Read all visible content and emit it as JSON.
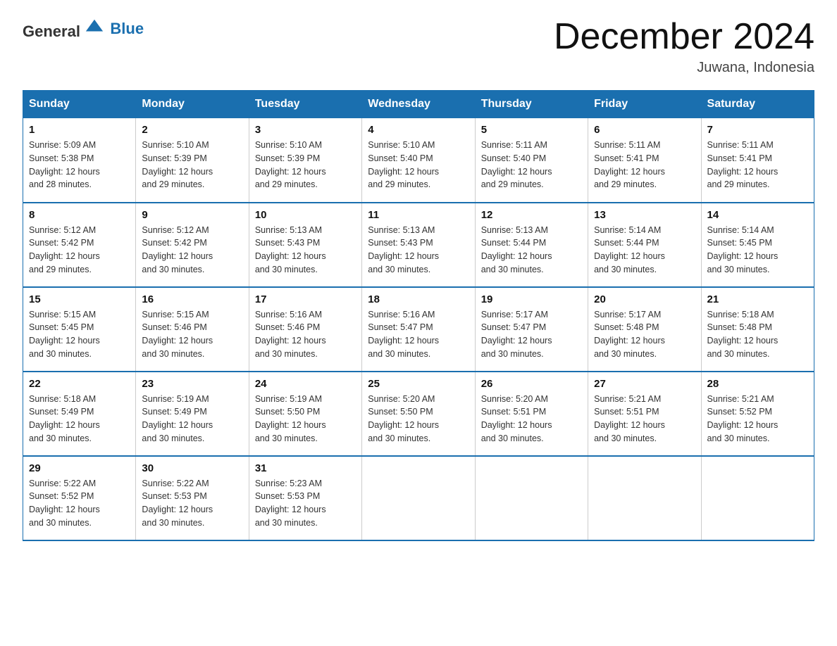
{
  "header": {
    "logo_general": "General",
    "logo_blue": "Blue",
    "title": "December 2024",
    "subtitle": "Juwana, Indonesia"
  },
  "days_of_week": [
    "Sunday",
    "Monday",
    "Tuesday",
    "Wednesday",
    "Thursday",
    "Friday",
    "Saturday"
  ],
  "weeks": [
    [
      {
        "day": "1",
        "sunrise": "5:09 AM",
        "sunset": "5:38 PM",
        "daylight": "12 hours and 28 minutes."
      },
      {
        "day": "2",
        "sunrise": "5:10 AM",
        "sunset": "5:39 PM",
        "daylight": "12 hours and 29 minutes."
      },
      {
        "day": "3",
        "sunrise": "5:10 AM",
        "sunset": "5:39 PM",
        "daylight": "12 hours and 29 minutes."
      },
      {
        "day": "4",
        "sunrise": "5:10 AM",
        "sunset": "5:40 PM",
        "daylight": "12 hours and 29 minutes."
      },
      {
        "day": "5",
        "sunrise": "5:11 AM",
        "sunset": "5:40 PM",
        "daylight": "12 hours and 29 minutes."
      },
      {
        "day": "6",
        "sunrise": "5:11 AM",
        "sunset": "5:41 PM",
        "daylight": "12 hours and 29 minutes."
      },
      {
        "day": "7",
        "sunrise": "5:11 AM",
        "sunset": "5:41 PM",
        "daylight": "12 hours and 29 minutes."
      }
    ],
    [
      {
        "day": "8",
        "sunrise": "5:12 AM",
        "sunset": "5:42 PM",
        "daylight": "12 hours and 29 minutes."
      },
      {
        "day": "9",
        "sunrise": "5:12 AM",
        "sunset": "5:42 PM",
        "daylight": "12 hours and 30 minutes."
      },
      {
        "day": "10",
        "sunrise": "5:13 AM",
        "sunset": "5:43 PM",
        "daylight": "12 hours and 30 minutes."
      },
      {
        "day": "11",
        "sunrise": "5:13 AM",
        "sunset": "5:43 PM",
        "daylight": "12 hours and 30 minutes."
      },
      {
        "day": "12",
        "sunrise": "5:13 AM",
        "sunset": "5:44 PM",
        "daylight": "12 hours and 30 minutes."
      },
      {
        "day": "13",
        "sunrise": "5:14 AM",
        "sunset": "5:44 PM",
        "daylight": "12 hours and 30 minutes."
      },
      {
        "day": "14",
        "sunrise": "5:14 AM",
        "sunset": "5:45 PM",
        "daylight": "12 hours and 30 minutes."
      }
    ],
    [
      {
        "day": "15",
        "sunrise": "5:15 AM",
        "sunset": "5:45 PM",
        "daylight": "12 hours and 30 minutes."
      },
      {
        "day": "16",
        "sunrise": "5:15 AM",
        "sunset": "5:46 PM",
        "daylight": "12 hours and 30 minutes."
      },
      {
        "day": "17",
        "sunrise": "5:16 AM",
        "sunset": "5:46 PM",
        "daylight": "12 hours and 30 minutes."
      },
      {
        "day": "18",
        "sunrise": "5:16 AM",
        "sunset": "5:47 PM",
        "daylight": "12 hours and 30 minutes."
      },
      {
        "day": "19",
        "sunrise": "5:17 AM",
        "sunset": "5:47 PM",
        "daylight": "12 hours and 30 minutes."
      },
      {
        "day": "20",
        "sunrise": "5:17 AM",
        "sunset": "5:48 PM",
        "daylight": "12 hours and 30 minutes."
      },
      {
        "day": "21",
        "sunrise": "5:18 AM",
        "sunset": "5:48 PM",
        "daylight": "12 hours and 30 minutes."
      }
    ],
    [
      {
        "day": "22",
        "sunrise": "5:18 AM",
        "sunset": "5:49 PM",
        "daylight": "12 hours and 30 minutes."
      },
      {
        "day": "23",
        "sunrise": "5:19 AM",
        "sunset": "5:49 PM",
        "daylight": "12 hours and 30 minutes."
      },
      {
        "day": "24",
        "sunrise": "5:19 AM",
        "sunset": "5:50 PM",
        "daylight": "12 hours and 30 minutes."
      },
      {
        "day": "25",
        "sunrise": "5:20 AM",
        "sunset": "5:50 PM",
        "daylight": "12 hours and 30 minutes."
      },
      {
        "day": "26",
        "sunrise": "5:20 AM",
        "sunset": "5:51 PM",
        "daylight": "12 hours and 30 minutes."
      },
      {
        "day": "27",
        "sunrise": "5:21 AM",
        "sunset": "5:51 PM",
        "daylight": "12 hours and 30 minutes."
      },
      {
        "day": "28",
        "sunrise": "5:21 AM",
        "sunset": "5:52 PM",
        "daylight": "12 hours and 30 minutes."
      }
    ],
    [
      {
        "day": "29",
        "sunrise": "5:22 AM",
        "sunset": "5:52 PM",
        "daylight": "12 hours and 30 minutes."
      },
      {
        "day": "30",
        "sunrise": "5:22 AM",
        "sunset": "5:53 PM",
        "daylight": "12 hours and 30 minutes."
      },
      {
        "day": "31",
        "sunrise": "5:23 AM",
        "sunset": "5:53 PM",
        "daylight": "12 hours and 30 minutes."
      },
      null,
      null,
      null,
      null
    ]
  ],
  "labels": {
    "sunrise": "Sunrise:",
    "sunset": "Sunset:",
    "daylight": "Daylight:"
  }
}
